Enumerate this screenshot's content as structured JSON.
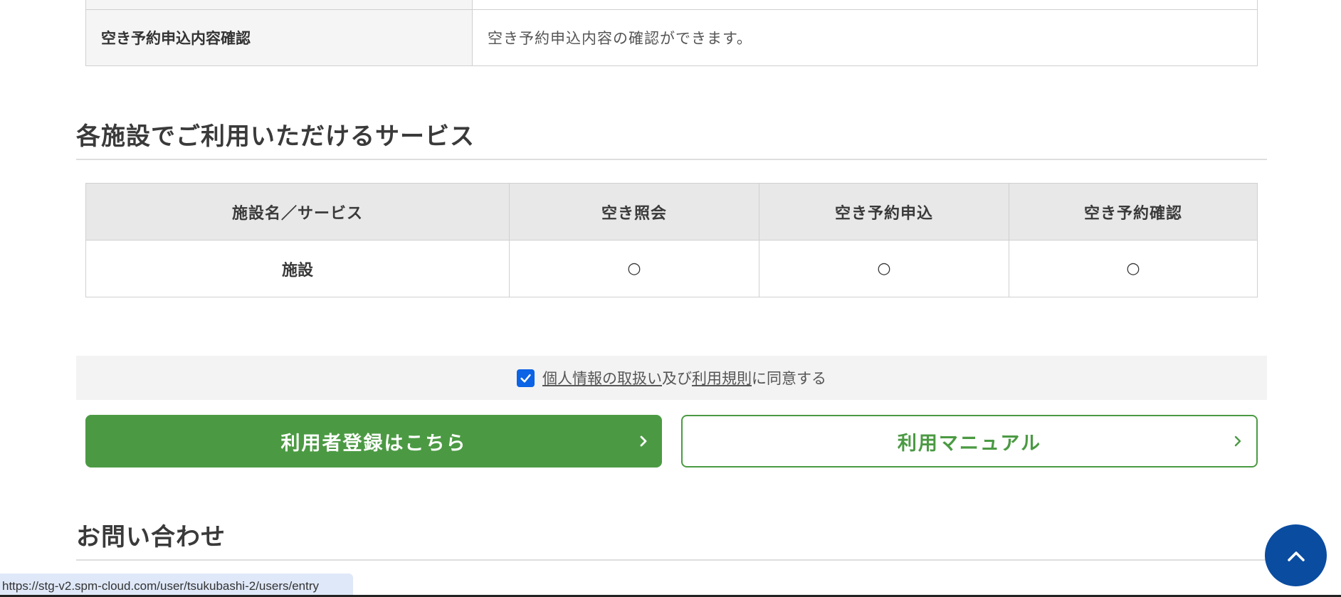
{
  "top_table": {
    "row_label": "空き予約申込内容確認",
    "row_value": "空き予約申込内容の確認ができます。"
  },
  "services": {
    "title": "各施設でご利用いただけるサービス",
    "headers": [
      "施設名／サービス",
      "空き照会",
      "空き予約申込",
      "空き予約確認"
    ],
    "rows": [
      {
        "name": "施設",
        "marks": [
          "○",
          "○",
          "○"
        ]
      }
    ]
  },
  "agree": {
    "checked": true,
    "link1": "個人情報の取扱い",
    "mid": "及び",
    "link2": "利用規則",
    "suffix": "に同意する"
  },
  "buttons": {
    "register": "利用者登録はこちら",
    "manual": "利用マニュアル"
  },
  "contact": {
    "title": "お問い合わせ"
  },
  "status_bar": {
    "url": "https://stg-v2.spm-cloud.com/user/tsukubashi-2/users/entry"
  },
  "colors": {
    "primary_green": "#4b9a43",
    "top_button_blue": "#0a4ca0",
    "checkbox_blue": "#0b63e5"
  },
  "icons": {
    "chevron": "chevron-right-icon",
    "to_top": "chevron-up-icon",
    "check": "check-icon"
  }
}
